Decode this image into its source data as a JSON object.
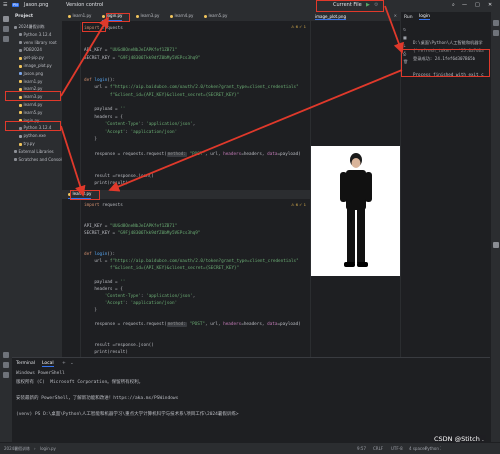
{
  "titlebar": {
    "app_name": "Jason.png",
    "project_label": "Version control",
    "run_config": "Current File"
  },
  "left_stripe_icons": [
    "folder-icon",
    "structure-icon",
    "more-icon"
  ],
  "project": {
    "header": "Project",
    "items": [
      {
        "label": "2024暑假训练",
        "kind": "folder",
        "indent": 0
      },
      {
        "label": "Python 3.12.4",
        "kind": "folder",
        "indent": 1
      },
      {
        "label": "venv library root",
        "kind": "folder",
        "indent": 1
      },
      {
        "label": "PDB2024",
        "kind": "folder",
        "indent": 1
      },
      {
        "label": "get-pip.py",
        "kind": "py",
        "indent": 1
      },
      {
        "label": "image_plot.py",
        "kind": "py",
        "indent": 1
      },
      {
        "label": "Jason.png",
        "kind": "png",
        "indent": 1
      },
      {
        "label": "learn1.py",
        "kind": "py",
        "indent": 1
      },
      {
        "label": "learn2.py",
        "kind": "py",
        "indent": 1
      },
      {
        "label": "learn3.py",
        "kind": "py",
        "indent": 1
      },
      {
        "label": "learn4.py",
        "kind": "py",
        "indent": 1
      },
      {
        "label": "learn5.py",
        "kind": "py",
        "indent": 1
      },
      {
        "label": "login.py",
        "kind": "py",
        "indent": 1
      },
      {
        "label": "Python 3.12.4",
        "kind": "folder",
        "indent": 1
      },
      {
        "label": "python.exe",
        "kind": "exe",
        "indent": 1
      },
      {
        "label": "try.py",
        "kind": "py",
        "indent": 1
      },
      {
        "label": "External Libraries",
        "kind": "folder",
        "indent": 0
      },
      {
        "label": "Scratches and Consoles",
        "kind": "folder",
        "indent": 0
      }
    ]
  },
  "top_tabs": [
    {
      "label": "learn1.py",
      "active": false
    },
    {
      "label": "login.py",
      "active": true
    },
    {
      "label": "learn3.py",
      "active": false
    },
    {
      "label": "learn4.py",
      "active": false
    },
    {
      "label": "learn5.py",
      "active": false
    }
  ],
  "bottom_tabs": [
    {
      "label": "learn2.py",
      "active": true
    }
  ],
  "image_tab": {
    "label": "image_plot.png"
  },
  "editor_top": {
    "warnings": "⚠ 6  ✓ 1",
    "size_info": "1.27 MB",
    "lines": [
      [
        {
          "t": "import ",
          "c": "kw"
        },
        {
          "t": "requests",
          "c": ""
        }
      ],
      [],
      [],
      [
        {
          "t": "API_KEY = ",
          "c": ""
        },
        {
          "t": "\"UUGd8OneNbJeIAPKfef1ZB71\"",
          "c": "str"
        }
      ],
      [
        {
          "t": "SECRET_KEY = ",
          "c": ""
        },
        {
          "t": "\"G9Fj48306Tkk9dfZ0bMy5VEPcs3hq9\"",
          "c": "str"
        }
      ],
      [],
      [],
      [
        {
          "t": "def ",
          "c": "kw"
        },
        {
          "t": "login",
          "c": "fn"
        },
        {
          "t": "():",
          "c": ""
        }
      ],
      [
        {
          "t": "    url = ",
          "c": ""
        },
        {
          "t": "f\"https://aip.baidubce.com/oauth/2.0/token?grant_type=client_credentials\"",
          "c": "str"
        }
      ],
      [
        {
          "t": "          ",
          "c": ""
        },
        {
          "t": "f\"&client_id={API_KEY}&client_secret={SECRET_KEY}\"",
          "c": "str"
        }
      ],
      [],
      [
        {
          "t": "    payload = ",
          "c": ""
        },
        {
          "t": "''",
          "c": "str"
        }
      ],
      [
        {
          "t": "    headers = {",
          "c": ""
        }
      ],
      [
        {
          "t": "        ",
          "c": ""
        },
        {
          "t": "'Content-Type'",
          "c": "str"
        },
        {
          "t": ": ",
          "c": ""
        },
        {
          "t": "'application/json'",
          "c": "str"
        },
        {
          "t": ",",
          "c": ""
        }
      ],
      [
        {
          "t": "        ",
          "c": ""
        },
        {
          "t": "'Accept'",
          "c": "str"
        },
        {
          "t": ": ",
          "c": ""
        },
        {
          "t": "'application/json'",
          "c": "str"
        }
      ],
      [
        {
          "t": "    }",
          "c": ""
        }
      ],
      [],
      [
        {
          "t": "    response = requests.request(",
          "c": ""
        },
        {
          "t": "method:",
          "c": "hint"
        },
        {
          "t": " \"POST\"",
          "c": "str"
        },
        {
          "t": ", url, ",
          "c": ""
        },
        {
          "t": "headers",
          "c": "var"
        },
        {
          "t": "=headers, ",
          "c": ""
        },
        {
          "t": "data",
          "c": "var"
        },
        {
          "t": "=payload)",
          "c": ""
        }
      ],
      [],
      [],
      [
        {
          "t": "    result =response.json()",
          "c": ""
        }
      ],
      [
        {
          "t": "    print(result)",
          "c": ""
        }
      ]
    ]
  },
  "editor_bottom": {
    "warnings": "⚠ 6  ✓ 1",
    "lines": [
      [
        {
          "t": "import ",
          "c": "kw"
        },
        {
          "t": "requests",
          "c": ""
        }
      ],
      [],
      [],
      [
        {
          "t": "API_KEY = ",
          "c": ""
        },
        {
          "t": "\"UUGd8OneNbJeIAPKfef1ZB71\"",
          "c": "str"
        }
      ],
      [
        {
          "t": "SECRET_KEY = ",
          "c": ""
        },
        {
          "t": "\"G9Fj48306Tkk9dfZ0bMy5VEPcs3hq9\"",
          "c": "str"
        }
      ],
      [],
      [],
      [
        {
          "t": "def ",
          "c": "kw"
        },
        {
          "t": "login",
          "c": "fn"
        },
        {
          "t": "():",
          "c": ""
        }
      ],
      [
        {
          "t": "    url = ",
          "c": ""
        },
        {
          "t": "f\"https://aip.baidubce.com/oauth/2.0/token?grant_type=client_credentials\"",
          "c": "str"
        }
      ],
      [
        {
          "t": "          ",
          "c": ""
        },
        {
          "t": "f\"&client_id={API_KEY}&client_secret={SECRET_KEY}\"",
          "c": "str"
        }
      ],
      [],
      [
        {
          "t": "    payload = ",
          "c": ""
        },
        {
          "t": "''",
          "c": "str"
        }
      ],
      [
        {
          "t": "    headers = {",
          "c": ""
        }
      ],
      [
        {
          "t": "        ",
          "c": ""
        },
        {
          "t": "'Content-Type'",
          "c": "str"
        },
        {
          "t": ": ",
          "c": ""
        },
        {
          "t": "'application/json'",
          "c": "str"
        },
        {
          "t": ",",
          "c": ""
        }
      ],
      [
        {
          "t": "        ",
          "c": ""
        },
        {
          "t": "'Accept'",
          "c": "str"
        },
        {
          "t": ": ",
          "c": ""
        },
        {
          "t": "'application/json'",
          "c": "str"
        }
      ],
      [
        {
          "t": "    }",
          "c": ""
        }
      ],
      [],
      [
        {
          "t": "    response = requests.request(",
          "c": ""
        },
        {
          "t": "method:",
          "c": "hint"
        },
        {
          "t": " \"POST\"",
          "c": "str"
        },
        {
          "t": ", url, ",
          "c": ""
        },
        {
          "t": "headers",
          "c": "var"
        },
        {
          "t": "=headers, ",
          "c": ""
        },
        {
          "t": "data",
          "c": "var"
        },
        {
          "t": "=payload)",
          "c": ""
        }
      ],
      [],
      [],
      [
        {
          "t": "    result =response.json()",
          "c": ""
        }
      ],
      [
        {
          "t": "    print(result)",
          "c": ""
        }
      ]
    ]
  },
  "run_panel": {
    "header": "Run",
    "tab": "login",
    "lines": [
      "D:\\桌面\\Python\\人工智能和机器学",
      "{'refresh_token': '25.0a7d0a",
      "登录成功: 24.1fef6d307B65b",
      "",
      "Process finished with exit c"
    ]
  },
  "terminal": {
    "tabs": [
      "Terminal",
      "Local"
    ],
    "lines": [
      "Windows PowerShell",
      "版权所有 (C)  Microsoft Corporation。保留所有权利。",
      "",
      "安装最新的 PowerShell，了解新功能和改进！https://aka.ms/PSWindows",
      "",
      "(venv) PS D:\\桌面\\Python\\人工智能和机器学习\\重点大学计算机科学与技术系\\项目工作\\2024暑假训练>"
    ]
  },
  "statusbar": {
    "breadcrumb_project": "2024暑假训练",
    "breadcrumb_file": "login.py",
    "position": "9:57",
    "line_ending": "CRLF",
    "encoding": "UTF-8",
    "indent": "4 spaces",
    "interpreter": "Python 3.12 (2024暑假训练)",
    "watermark": "CSDN @Stitch ."
  },
  "colors": {
    "annotation_red": "#e0392b",
    "accent_blue": "#3574f0"
  }
}
